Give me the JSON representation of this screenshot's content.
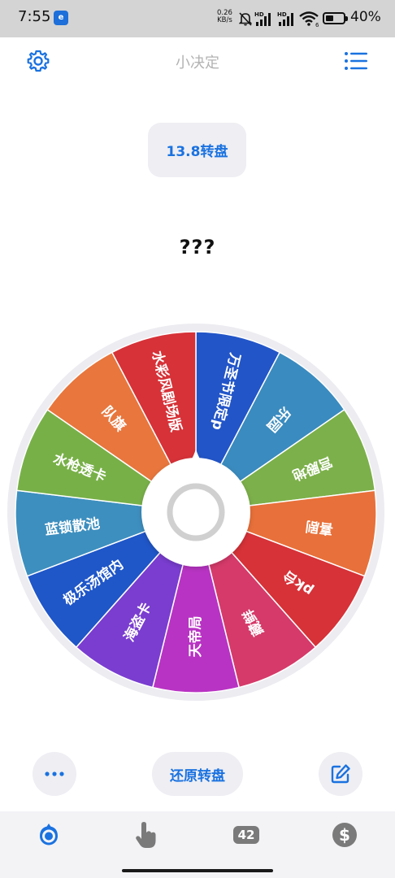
{
  "status_bar": {
    "time": "7:55",
    "app_icon_text": "e",
    "net_speed_value": "0.26",
    "net_speed_unit": "KB/s",
    "signal1_label": "HD",
    "signal2_label": "HD",
    "wifi_label": "6",
    "battery": "40%",
    "battery_level": 0.4
  },
  "header": {
    "title": "小决定",
    "settings_icon": "gear-icon",
    "list_icon": "list-icon"
  },
  "wheel_name": "13.8转盘",
  "result": "???",
  "wheel": {
    "segments": [
      {
        "label": "万圣节限定p",
        "color": "#2255c8"
      },
      {
        "label": "乐园",
        "color": "#3a8bbf"
      },
      {
        "label": "宫殿地",
        "color": "#7cb04a"
      },
      {
        "label": "喜剧",
        "color": "#e8703a"
      },
      {
        "label": "pk台",
        "color": "#d63238"
      },
      {
        "label": "藏鲜",
        "color": "#d53a6a"
      },
      {
        "label": "天帝局",
        "color": "#b833c3"
      },
      {
        "label": "海盗卡",
        "color": "#7a3dd0"
      },
      {
        "label": "极乐汤馆内",
        "color": "#1f56c8"
      },
      {
        "label": "蓝锁散池",
        "color": "#3d8fbf"
      },
      {
        "label": "水枪透卡",
        "color": "#78b048"
      },
      {
        "label": "队旗",
        "color": "#e8763d"
      },
      {
        "label": "水彩风剧场版",
        "color": "#d63238"
      }
    ]
  },
  "actions": {
    "more_icon": "more-icon",
    "reset_label": "还原转盘",
    "edit_icon": "edit-icon"
  },
  "tabs": {
    "items": [
      {
        "name": "wheel",
        "icon": "wheel-icon",
        "active": true
      },
      {
        "name": "tap",
        "icon": "hand-pointer-icon",
        "active": false
      },
      {
        "name": "number",
        "badge": "42",
        "active": false
      },
      {
        "name": "coin",
        "icon": "dollar-icon",
        "active": false
      }
    ]
  },
  "colors": {
    "accent": "#1a72e0",
    "status_bar_bg": "#d4d4d4",
    "pill_bg": "#eeeef3"
  }
}
